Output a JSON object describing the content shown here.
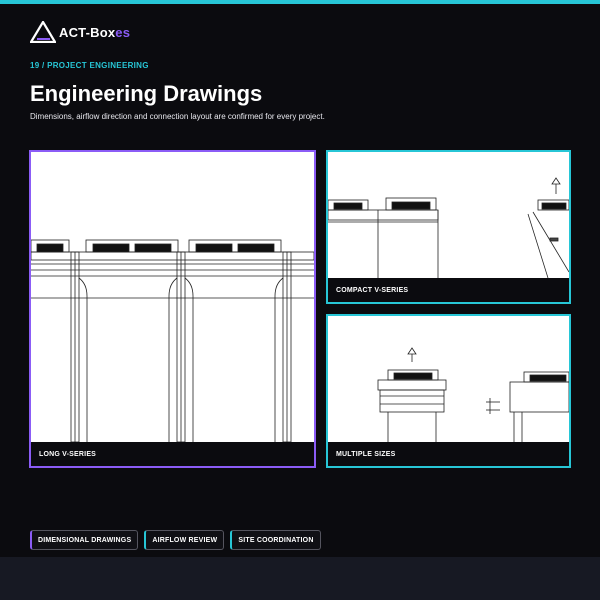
{
  "brand": {
    "name_main": "ACT-Box",
    "name_accent": "es",
    "logo_icon": "triangle-logo-icon",
    "accent_color": "#8b5cf6",
    "highlight_color": "#27c6d6"
  },
  "header": {
    "eyebrow": "19 / PROJECT ENGINEERING",
    "title": "Engineering Drawings",
    "subtitle": "Dimensions, airflow direction and connection layout are confirmed for every project."
  },
  "cards": [
    {
      "caption": "LONG V-SERIES",
      "border": "#8b5cf6"
    },
    {
      "caption": "COMPACT V-SERIES",
      "border": "#27c6d6"
    },
    {
      "caption": "MULTIPLE SIZES",
      "border": "#27c6d6"
    }
  ],
  "tags": [
    {
      "label": "DIMENSIONAL DRAWINGS",
      "accent": "#8b5cf6"
    },
    {
      "label": "AIRFLOW REVIEW",
      "accent": "#27c6d6"
    },
    {
      "label": "SITE COORDINATION",
      "accent": "#27c6d6"
    }
  ]
}
